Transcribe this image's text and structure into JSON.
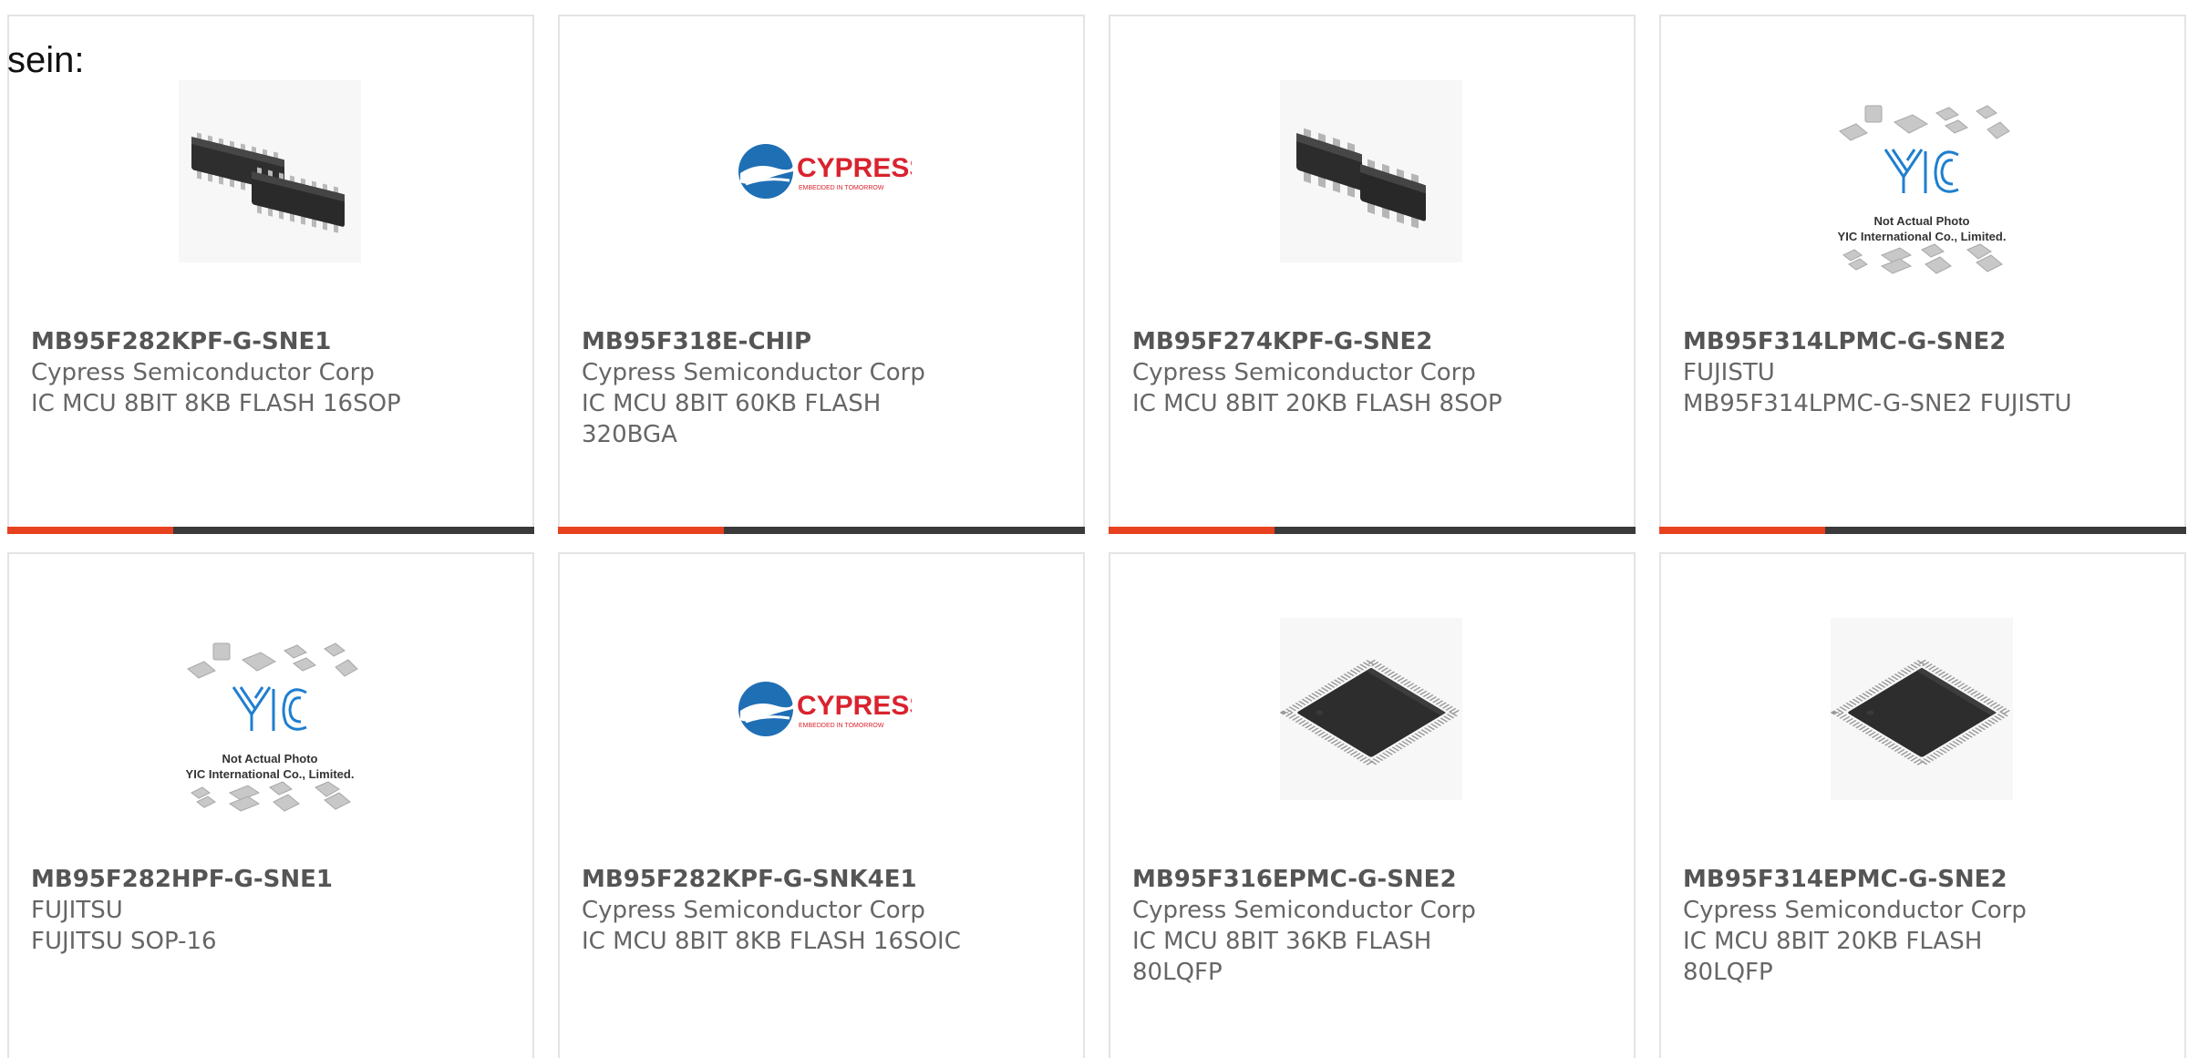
{
  "intro_text": "sein:",
  "colors": {
    "accent": "#e8411f",
    "bar": "#3a3a3a",
    "cypress_blue": "#1f6fb5",
    "cypress_red": "#d9232e"
  },
  "products": [
    {
      "part_number": "MB95F282KPF-G-SNE1",
      "manufacturer": "Cypress Semiconductor Corp",
      "description": "IC MCU 8BIT 8KB FLASH 16SOP",
      "image": "sop16-chip-photo"
    },
    {
      "part_number": "MB95F318E-CHIP",
      "manufacturer": "Cypress Semiconductor Corp",
      "description": "IC MCU 8BIT 60KB FLASH 320BGA",
      "image": "cypress-logo",
      "logo_text": "CYPRESS",
      "logo_tagline": "EMBEDDED IN TOMORROW"
    },
    {
      "part_number": "MB95F274KPF-G-SNE2",
      "manufacturer": "Cypress Semiconductor Corp",
      "description": "IC MCU 8BIT 20KB FLASH 8SOP",
      "image": "sop8-chip-photo"
    },
    {
      "part_number": "MB95F314LPMC-G-SNE2",
      "manufacturer": "FUJISTU",
      "description": "MB95F314LPMC-G-SNE2 FUJISTU",
      "image": "yic-placeholder",
      "placeholder_line1": "Not Actual Photo",
      "placeholder_line2": "YIC International Co., Limited."
    },
    {
      "part_number": "MB95F282HPF-G-SNE1",
      "manufacturer": "FUJITSU",
      "description": "FUJITSU SOP-16",
      "image": "yic-placeholder",
      "placeholder_line1": "Not Actual Photo",
      "placeholder_line2": "YIC International Co., Limited."
    },
    {
      "part_number": "MB95F282KPF-G-SNK4E1",
      "manufacturer": "Cypress Semiconductor Corp",
      "description": "IC MCU 8BIT 8KB FLASH 16SOIC",
      "image": "cypress-logo",
      "logo_text": "CYPRESS",
      "logo_tagline": "EMBEDDED IN TOMORROW"
    },
    {
      "part_number": "MB95F316EPMC-G-SNE2",
      "manufacturer": "Cypress Semiconductor Corp",
      "description": "IC MCU 8BIT 36KB FLASH 80LQFP",
      "image": "lqfp80-chip-photo"
    },
    {
      "part_number": "MB95F314EPMC-G-SNE2",
      "manufacturer": "Cypress Semiconductor Corp",
      "description": "IC MCU 8BIT 20KB FLASH 80LQFP",
      "image": "lqfp80-chip-photo"
    }
  ]
}
